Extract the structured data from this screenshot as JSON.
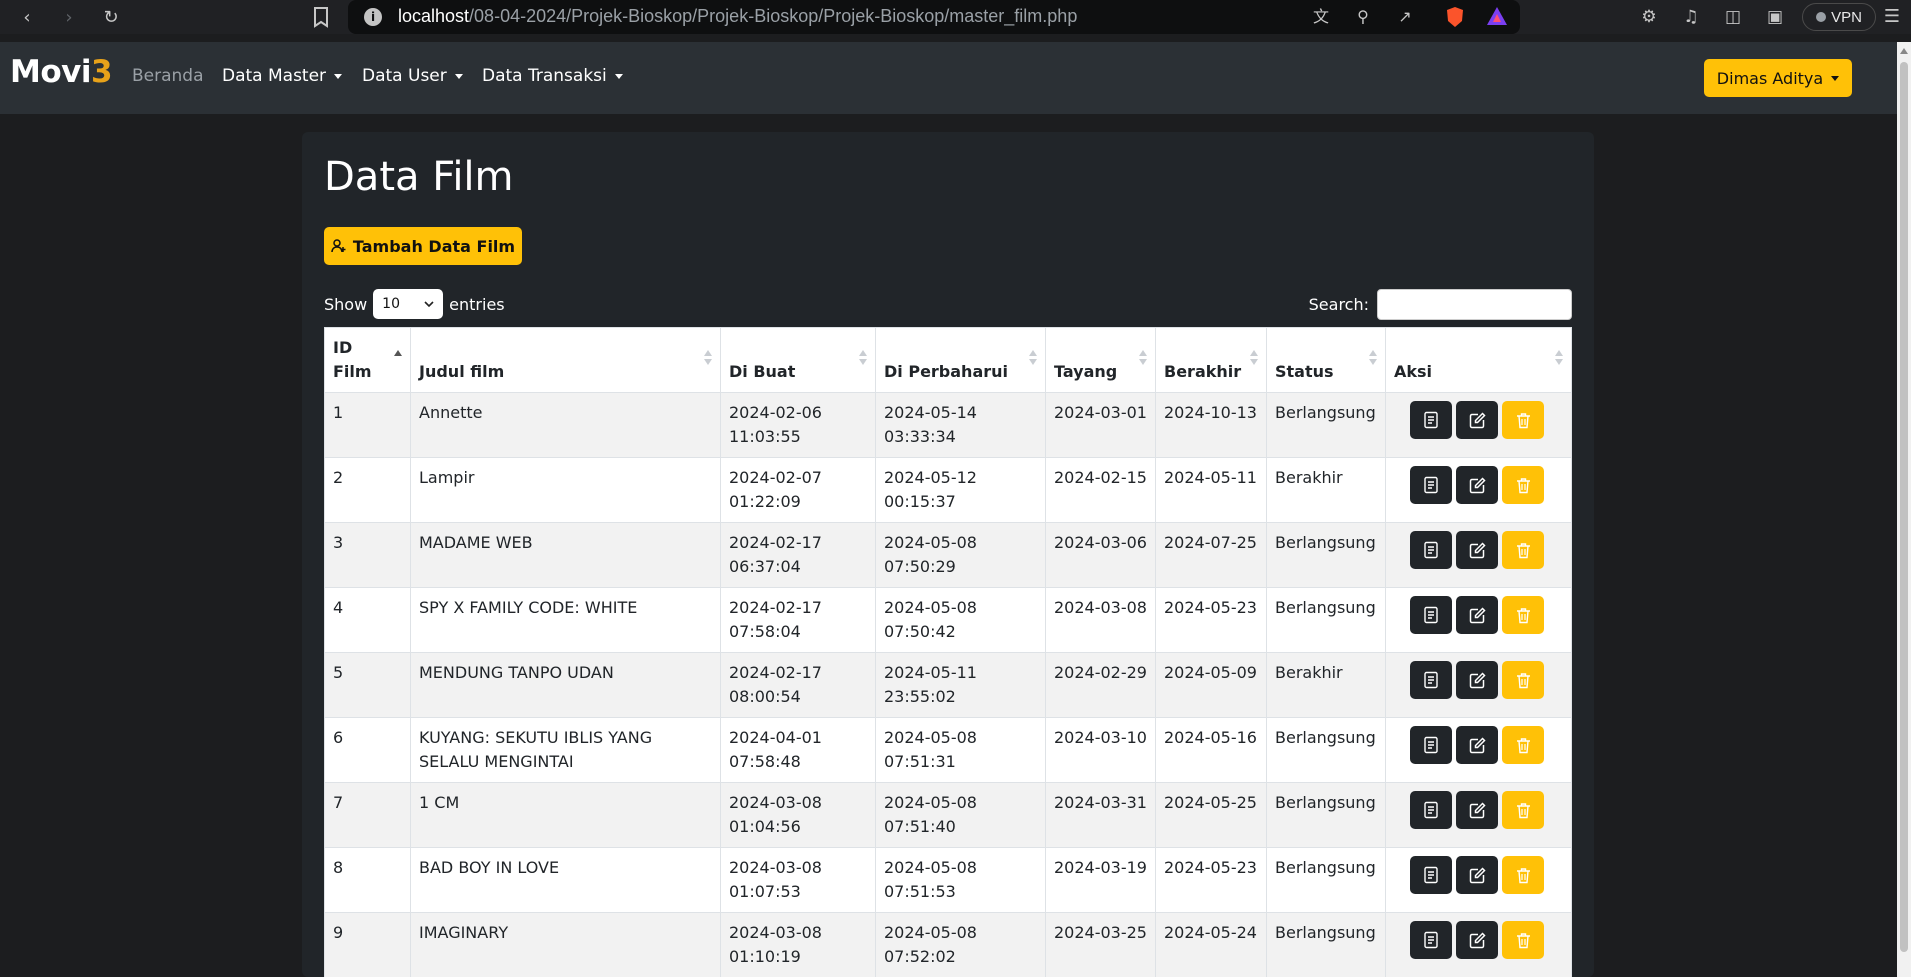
{
  "browser": {
    "url_host": "localhost",
    "url_path": "/08-04-2024/Projek-Bioskop/Projek-Bioskop/Projek-Bioskop/master_film.php",
    "vpn_label": "VPN"
  },
  "navbar": {
    "brand_main": "Movi",
    "brand_accent": "3",
    "links": [
      {
        "label": "Beranda"
      },
      {
        "label": "Data Master"
      },
      {
        "label": "Data User"
      },
      {
        "label": "Data Transaksi"
      }
    ],
    "user_label": "Dimas Aditya"
  },
  "page": {
    "title": "Data Film",
    "add_button": "Tambah Data Film",
    "show_label": "Show",
    "entries_value": "10",
    "entries_label": "entries",
    "search_label": "Search:"
  },
  "table": {
    "headers": [
      "ID Film",
      "Judul film",
      "Di Buat",
      "Di Perbaharui",
      "Tayang",
      "Berakhir",
      "Status",
      "Aksi"
    ],
    "rows": [
      {
        "id": "1",
        "judul": "Annette",
        "dibuat": "2024-02-06 11:03:55",
        "diperbaharui": "2024-05-14 03:33:34",
        "tayang": "2024-03-01",
        "berakhir": "2024-10-13",
        "status": "Berlangsung"
      },
      {
        "id": "2",
        "judul": "Lampir",
        "dibuat": "2024-02-07 01:22:09",
        "diperbaharui": "2024-05-12 00:15:37",
        "tayang": "2024-02-15",
        "berakhir": "2024-05-11",
        "status": "Berakhir"
      },
      {
        "id": "3",
        "judul": "MADAME WEB",
        "dibuat": "2024-02-17 06:37:04",
        "diperbaharui": "2024-05-08 07:50:29",
        "tayang": "2024-03-06",
        "berakhir": "2024-07-25",
        "status": "Berlangsung"
      },
      {
        "id": "4",
        "judul": "SPY X FAMILY CODE: WHITE",
        "dibuat": "2024-02-17 07:58:04",
        "diperbaharui": "2024-05-08 07:50:42",
        "tayang": "2024-03-08",
        "berakhir": "2024-05-23",
        "status": "Berlangsung"
      },
      {
        "id": "5",
        "judul": "MENDUNG TANPO UDAN",
        "dibuat": "2024-02-17 08:00:54",
        "diperbaharui": "2024-05-11 23:55:02",
        "tayang": "2024-02-29",
        "berakhir": "2024-05-09",
        "status": "Berakhir"
      },
      {
        "id": "6",
        "judul": "KUYANG: SEKUTU IBLIS YANG SELALU MENGINTAI",
        "dibuat": "2024-04-01 07:58:48",
        "diperbaharui": "2024-05-08 07:51:31",
        "tayang": "2024-03-10",
        "berakhir": "2024-05-16",
        "status": "Berlangsung"
      },
      {
        "id": "7",
        "judul": "1 CM",
        "dibuat": "2024-03-08 01:04:56",
        "diperbaharui": "2024-05-08 07:51:40",
        "tayang": "2024-03-31",
        "berakhir": "2024-05-25",
        "status": "Berlangsung"
      },
      {
        "id": "8",
        "judul": "BAD BOY IN LOVE",
        "dibuat": "2024-03-08 01:07:53",
        "diperbaharui": "2024-05-08 07:51:53",
        "tayang": "2024-03-19",
        "berakhir": "2024-05-23",
        "status": "Berlangsung"
      },
      {
        "id": "9",
        "judul": "IMAGINARY",
        "dibuat": "2024-03-08 01:10:19",
        "diperbaharui": "2024-05-08 07:52:02",
        "tayang": "2024-03-25",
        "berakhir": "2024-05-24",
        "status": "Berlangsung"
      }
    ]
  },
  "colors": {
    "accent": "#ffc107",
    "brand_accent": "#e8a21a",
    "navbar": "#2b3035",
    "background": "#1c1d1f",
    "card": "#212529",
    "action_dark": "#212529"
  },
  "icons": {
    "detail": "document-icon",
    "edit": "edit-icon",
    "delete": "trash-icon",
    "add": "add-user-icon"
  }
}
